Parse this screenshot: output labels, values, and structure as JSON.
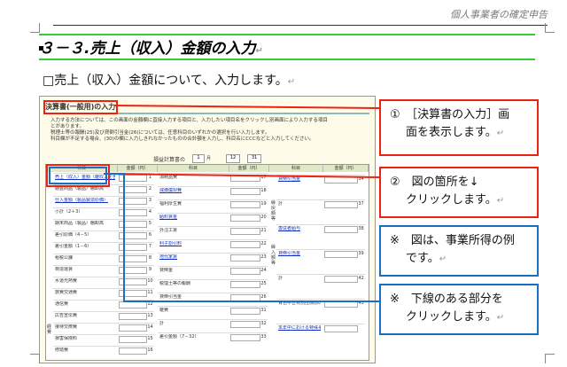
{
  "header": {
    "running_title": "個人事業者の確定申告"
  },
  "section": {
    "title": "３－３.売上（収入）金額の入力"
  },
  "intro": {
    "text": "□売上（収入）金額について、入力します。"
  },
  "screenshot": {
    "title": "決算書(一般用)の入力",
    "desc_1": "入力する方法については、この画面の金額欄に直接入力する項目と、入力したい項目名をクリックし別画面により入力する項目",
    "desc_2": "とがあります。",
    "desc_3": "税理士等の報酬(25)及び貸倒引当金(26)については、任意科目のいずれかの選択を行い入力します。",
    "desc_4": "科目欄が不足する場合、(30)の欄に入力しきれなかったものの合計額を入力し、科目名にCCCなどと入力してください。",
    "calc_label": "損益計算書の",
    "calc_month_1": "1",
    "calc_day_1": "月",
    "calc_month_2": "12",
    "calc_day_2": "31",
    "col_kamoku": "科目",
    "col_kingaku": "金額（円）",
    "left_rows": [
      {
        "label": "売上（収入）金額（雑収入を含む）",
        "link": true,
        "num": "1"
      },
      {
        "label": "期首商品（製品）棚卸高",
        "link": false,
        "num": "2"
      },
      {
        "label": "仕入金額（製品製造原価）",
        "link": true,
        "num": "3"
      },
      {
        "label": "小計（2＋3）",
        "link": false,
        "num": "4"
      },
      {
        "label": "期末商品（製品）棚卸高",
        "link": false,
        "num": "5"
      },
      {
        "label": "差引原価（4－5）",
        "link": false,
        "num": "6"
      },
      {
        "label": "差引金額（1－6）",
        "link": false,
        "num": "7"
      },
      {
        "label": "租税公課",
        "link": false,
        "num": "8"
      },
      {
        "label": "荷造運賃",
        "link": false,
        "num": "9"
      },
      {
        "label": "水道光熱費",
        "link": false,
        "num": "10"
      },
      {
        "label": "旅費交通費",
        "link": false,
        "num": "11"
      },
      {
        "label": "通信費",
        "link": false,
        "num": "12"
      },
      {
        "label": "広告宣伝費",
        "link": false,
        "num": "13"
      },
      {
        "label": "接待交際費",
        "link": false,
        "num": "14"
      },
      {
        "label": "損害保険料",
        "link": false,
        "num": "15"
      },
      {
        "label": "修繕費",
        "link": false,
        "num": "16"
      }
    ],
    "mid_rows": [
      {
        "label": "消耗品費",
        "link": false,
        "num": "17"
      },
      {
        "label": "減価償却費",
        "link": true,
        "num": "18"
      },
      {
        "label": "福利厚生費",
        "link": false,
        "num": "19"
      },
      {
        "label": "給料賃金",
        "link": true,
        "num": "20"
      },
      {
        "label": "外注工賃",
        "link": false,
        "num": "21"
      },
      {
        "label": "利子割引料",
        "link": true,
        "num": "22"
      },
      {
        "label": "地代家賃",
        "link": true,
        "num": "23"
      },
      {
        "label": "貸倒金",
        "link": false,
        "num": "24"
      },
      {
        "label": "税理士等の報酬",
        "link": false,
        "num": "25"
      },
      {
        "label": "貸倒引当金",
        "link": false,
        "num": "26"
      },
      {
        "label": "雑費",
        "link": false,
        "num": "31"
      },
      {
        "label": "計",
        "link": false,
        "num": "32"
      },
      {
        "label": "差引金額（7－32）",
        "link": false,
        "num": "33"
      }
    ],
    "right_rows": [
      {
        "label": "貸倒引当金",
        "link": true,
        "num": "34"
      },
      {
        "label": "計",
        "link": false,
        "num": "37"
      },
      {
        "label": "専従者給与",
        "link": true,
        "num": "38"
      },
      {
        "label": "貸倒引当金",
        "link": true,
        "num": "39"
      },
      {
        "label": "計",
        "link": false,
        "num": "42"
      },
      {
        "label": "青色申告特別控除前の所得金額（33＋37－42）",
        "link": false,
        "num": "43"
      },
      {
        "label": "本年中における特殊事情",
        "link": true,
        "num": ""
      }
    ],
    "sidebar_labels": {
      "keihi": "経費",
      "kurimodoshi": "繰戻額等",
      "kuriire": "繰入額等"
    }
  },
  "callouts": [
    {
      "line1": "①　［決算書の入力］画",
      "line2": "面を表示します。"
    },
    {
      "line1": "②　図の箇所を↓",
      "line2": "クリックします。"
    },
    {
      "line1": "※　図は、事業所得の例",
      "line2": "です。"
    },
    {
      "line1": "※　下線のある部分を",
      "line2": "クリックします。"
    }
  ],
  "return_mark": "↵",
  "colors": {
    "accent_red": "#e21111",
    "accent_blue": "#1a6fc0",
    "rule_green": "#33cc33"
  }
}
